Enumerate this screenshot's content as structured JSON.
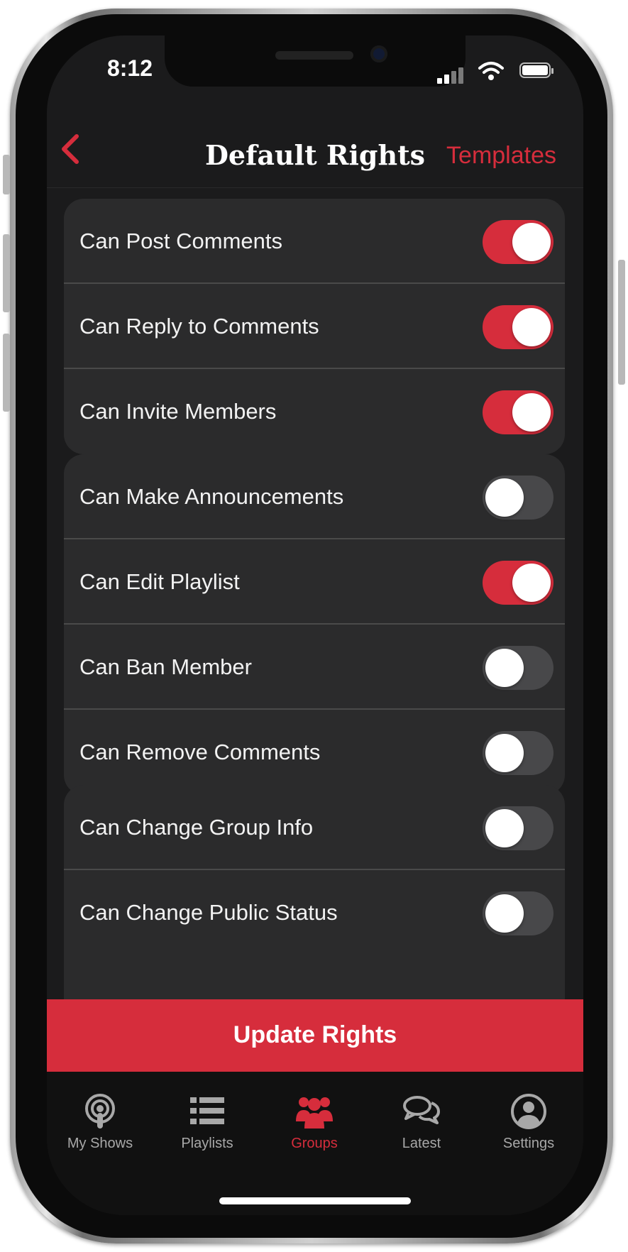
{
  "status_bar": {
    "time": "8:12"
  },
  "nav": {
    "title": "Default Rights",
    "right_action": "Templates"
  },
  "groups": [
    {
      "rows": [
        {
          "label": "Can Post Comments",
          "on": true
        },
        {
          "label": "Can Reply to Comments",
          "on": true
        },
        {
          "label": "Can Invite Members",
          "on": true
        }
      ]
    },
    {
      "rows": [
        {
          "label": "Can Make Announcements",
          "on": false
        },
        {
          "label": "Can Edit Playlist",
          "on": true
        },
        {
          "label": "Can Ban Member",
          "on": false
        },
        {
          "label": "Can Remove Comments",
          "on": false
        }
      ]
    },
    {
      "rows": [
        {
          "label": "Can Change Group Info",
          "on": false
        },
        {
          "label": "Can Change Public Status",
          "on": false
        }
      ]
    }
  ],
  "update_button": "Update Rights",
  "tabbar": {
    "items": [
      {
        "label": "My Shows",
        "icon": "podcast-icon",
        "active": false
      },
      {
        "label": "Playlists",
        "icon": "list-icon",
        "active": false
      },
      {
        "label": "Groups",
        "icon": "group-icon",
        "active": true
      },
      {
        "label": "Latest",
        "icon": "chat-bubbles-icon",
        "active": false
      },
      {
        "label": "Settings",
        "icon": "person-circle-icon",
        "active": false
      }
    ]
  },
  "colors": {
    "accent": "#d62d3c",
    "background": "#1b1b1c",
    "row": "#2b2b2c",
    "toggle_off": "#48484a"
  }
}
